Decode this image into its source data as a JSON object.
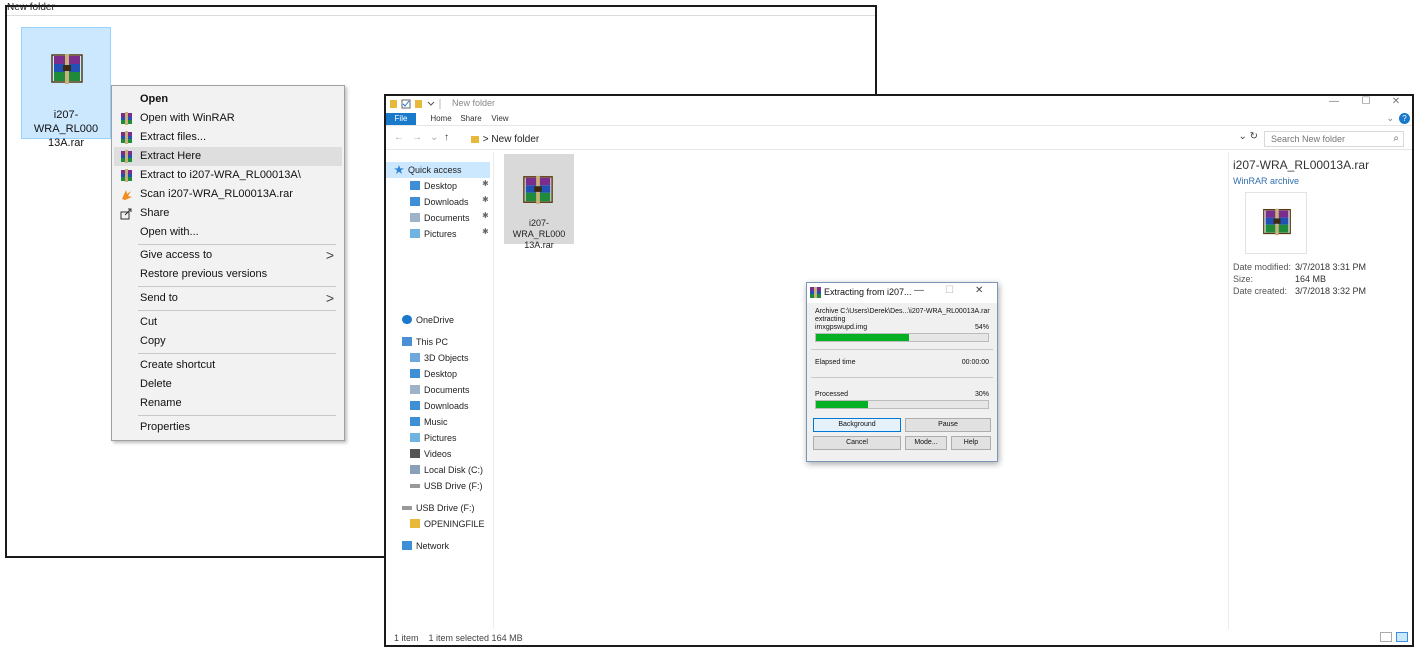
{
  "back_window": {
    "title": "New folder",
    "file": {
      "name_line1": "i207-WRA_RL000",
      "name_line2": "13A.rar",
      "icon": "winrar-archive-icon"
    }
  },
  "context_menu": {
    "items": [
      {
        "label": "Open",
        "bold": true,
        "icon": ""
      },
      {
        "label": "Open with WinRAR",
        "icon": "winrar-icon"
      },
      {
        "label": "Extract files...",
        "icon": "winrar-icon"
      },
      {
        "label": "Extract Here",
        "icon": "winrar-icon",
        "highlighted": true
      },
      {
        "label": "Extract to i207-WRA_RL00013A\\",
        "icon": "winrar-icon"
      },
      {
        "label": "Scan i207-WRA_RL00013A.rar",
        "icon": "antivirus-icon"
      },
      {
        "label": "Share",
        "icon": "share-icon"
      },
      {
        "label": "Open with...",
        "icon": ""
      },
      {
        "label": "Give access to",
        "icon": "",
        "submenu": true
      },
      {
        "label": "Restore previous versions",
        "icon": ""
      },
      {
        "label": "Send to",
        "icon": "",
        "submenu": true
      },
      {
        "label": "Cut",
        "icon": ""
      },
      {
        "label": "Copy",
        "icon": ""
      },
      {
        "label": "Create shortcut",
        "icon": ""
      },
      {
        "label": "Delete",
        "icon": ""
      },
      {
        "label": "Rename",
        "icon": ""
      },
      {
        "label": "Properties",
        "icon": ""
      }
    ],
    "submenu_arrow": ">"
  },
  "explorer": {
    "title": "New folder",
    "window_controls": {
      "minimize": "—",
      "maximize": "☐",
      "close": "✕"
    },
    "ribbon_tabs": [
      "File",
      "Home",
      "Share",
      "View"
    ],
    "nav": {
      "back": "←",
      "forward": "→",
      "recent": "⌄",
      "up": "↑"
    },
    "address": {
      "separator": ">",
      "location": "New folder"
    },
    "search_placeholder": "Search New folder",
    "nav_pane": {
      "quick_access": "Quick access",
      "quick_items": [
        "Desktop",
        "Downloads",
        "Documents",
        "Pictures"
      ],
      "onedrive": "OneDrive",
      "this_pc": "This PC",
      "pc_items": [
        "3D Objects",
        "Desktop",
        "Documents",
        "Downloads",
        "Music",
        "Pictures",
        "Videos",
        "Local Disk (C:)",
        "USB Drive (F:)"
      ],
      "usb_drive": "USB Drive (F:)",
      "usb_items": [
        "OPENINGFILE"
      ],
      "network": "Network"
    },
    "file": {
      "name_line1": "i207-WRA_RL000",
      "name_line2": "13A.rar"
    },
    "details": {
      "name": "i207-WRA_RL00013A.rar",
      "type": "WinRAR archive",
      "rows": [
        {
          "key": "Date modified:",
          "value": "3/7/2018 3:31 PM"
        },
        {
          "key": "Size:",
          "value": "164 MB"
        },
        {
          "key": "Date created:",
          "value": "3/7/2018 3:32 PM"
        }
      ]
    },
    "status": {
      "items": "1 item",
      "selected": "1 item selected  164 MB"
    }
  },
  "extract_dialog": {
    "title": "Extracting from i207...",
    "controls": {
      "minimize": "—",
      "maximize": "☐",
      "close": "✕"
    },
    "archive_line": "Archive C:\\Users\\Derek\\Des...\\i207-WRA_RL00013A.rar",
    "action": "extracting",
    "current_file": "imxgpswupd.img",
    "file_percent_label": "54%",
    "file_progress": 0.54,
    "elapsed_label": "Elapsed time",
    "elapsed_value": "00:00:00",
    "processed_label": "Processed",
    "processed_percent_label": "30%",
    "processed_progress": 0.3,
    "buttons": {
      "background": "Background",
      "pause": "Pause",
      "cancel": "Cancel",
      "mode": "Mode...",
      "help": "Help"
    }
  },
  "colors": {
    "selection": "#cce8ff",
    "accent": "#1979ca",
    "progress": "#06b025"
  }
}
